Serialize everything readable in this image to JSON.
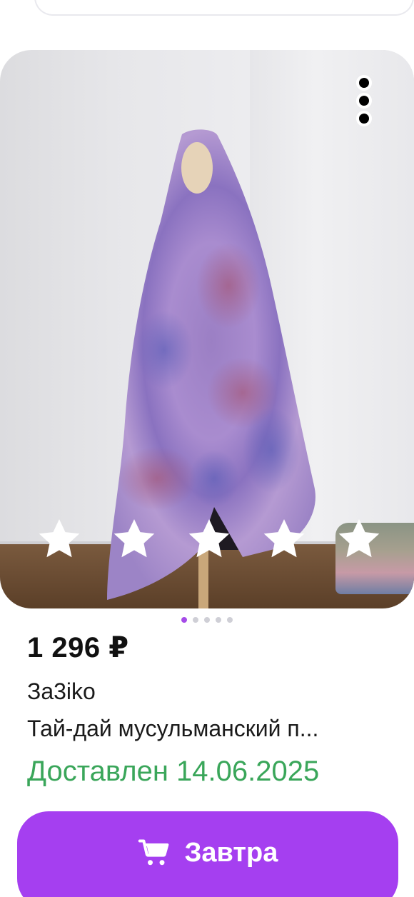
{
  "product": {
    "price": "1 296 ₽",
    "seller": "За3iko",
    "title": "Тай-дай мусульманский п...",
    "delivery_status": "Доставлен 14.06.2025"
  },
  "gallery": {
    "rating_stars": 5,
    "active_slide": 1,
    "slide_count": 5
  },
  "cta": {
    "label": "Завтра",
    "icon": "cart-icon"
  },
  "colors": {
    "accent": "#a53ff0",
    "delivery_green": "#3aa65a",
    "pager_active": "#a54be8"
  }
}
